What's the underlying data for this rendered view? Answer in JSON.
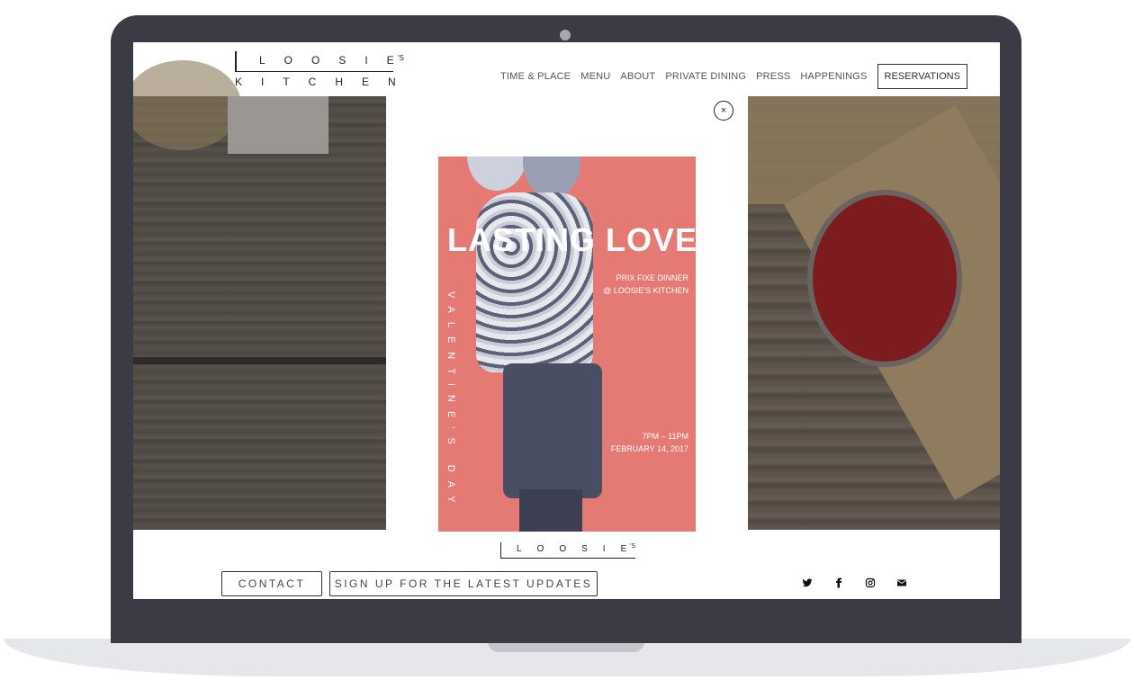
{
  "logo": {
    "top": "LOOSIE",
    "sup": "'S",
    "bottom": "KITCHEN"
  },
  "nav": {
    "items": [
      "TIME & PLACE",
      "MENU",
      "ABOUT",
      "PRIVATE DINING",
      "PRESS",
      "HAPPENINGS"
    ],
    "reservations": "RESERVATIONS"
  },
  "modal": {
    "close": "×",
    "poster": {
      "title": "LASTING LOVE",
      "line1": "PRIX FIXE DINNER",
      "line2": "@ LOOSIE'S KITCHEN",
      "vertical": "VALENTINE'S DAY",
      "time": "7PM – 11PM",
      "date": "FEBRUARY 14, 2017"
    }
  },
  "footer": {
    "logo": "LOOSIE",
    "logo_sup": "'S",
    "contact": "CONTACT",
    "signup": "SIGN UP FOR THE LATEST UPDATES",
    "social_icons": [
      "twitter-icon",
      "facebook-icon",
      "instagram-icon",
      "email-icon"
    ]
  },
  "colors": {
    "poster": "#e57973",
    "bezel": "#3b3b46"
  }
}
